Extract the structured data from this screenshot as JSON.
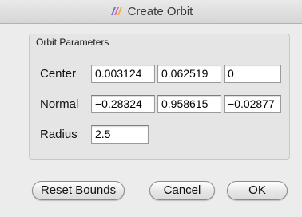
{
  "window": {
    "title": "Create Orbit",
    "icon": "orbit-app-icon"
  },
  "group": {
    "title": "Orbit Parameters"
  },
  "center": {
    "label": "Center",
    "x": "0.003124",
    "y": "0.062519",
    "z": "0"
  },
  "normal": {
    "label": "Normal",
    "x": "−0.28324",
    "y": "0.958615",
    "z": "−0.02877"
  },
  "radius": {
    "label": "Radius",
    "value": "2.5"
  },
  "buttons": {
    "reset_bounds": "Reset Bounds",
    "cancel": "Cancel",
    "ok": "OK"
  }
}
